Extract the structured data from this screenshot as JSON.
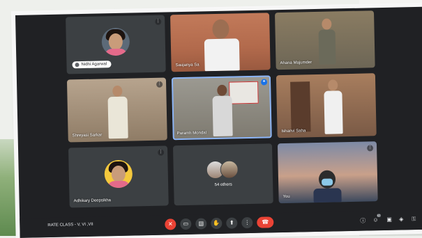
{
  "tiles": {
    "nidhi": {
      "label": "Nidhi Agarwal"
    },
    "saujanya": {
      "label": "Saujanya Sa"
    },
    "ahana": {
      "label": "Ahana Majumder"
    },
    "shreyasi": {
      "label": "Shreyasi Sarkar"
    },
    "paramh": {
      "label": "Paramh Mondal"
    },
    "ishanvi": {
      "label": "Ishanvi Saha"
    },
    "adhikary": {
      "label": "Adhikary Deepsikha"
    },
    "others": {
      "label": "54 others"
    },
    "you": {
      "label": "You"
    }
  },
  "meeting": {
    "name": "RATE CLASS - V, VI ,VII"
  },
  "icons": {
    "mic": "mic-off-icon",
    "cam": "camera-icon",
    "captions": "captions-icon",
    "hand": "raise-hand-icon",
    "present": "present-icon",
    "more": "more-icon",
    "end": "end-call-icon"
  },
  "participants_badge": "62",
  "colors": {
    "end_red": "#ea4335",
    "tile_bg": "#3c4043",
    "active_outline": "#8ab4f8"
  }
}
